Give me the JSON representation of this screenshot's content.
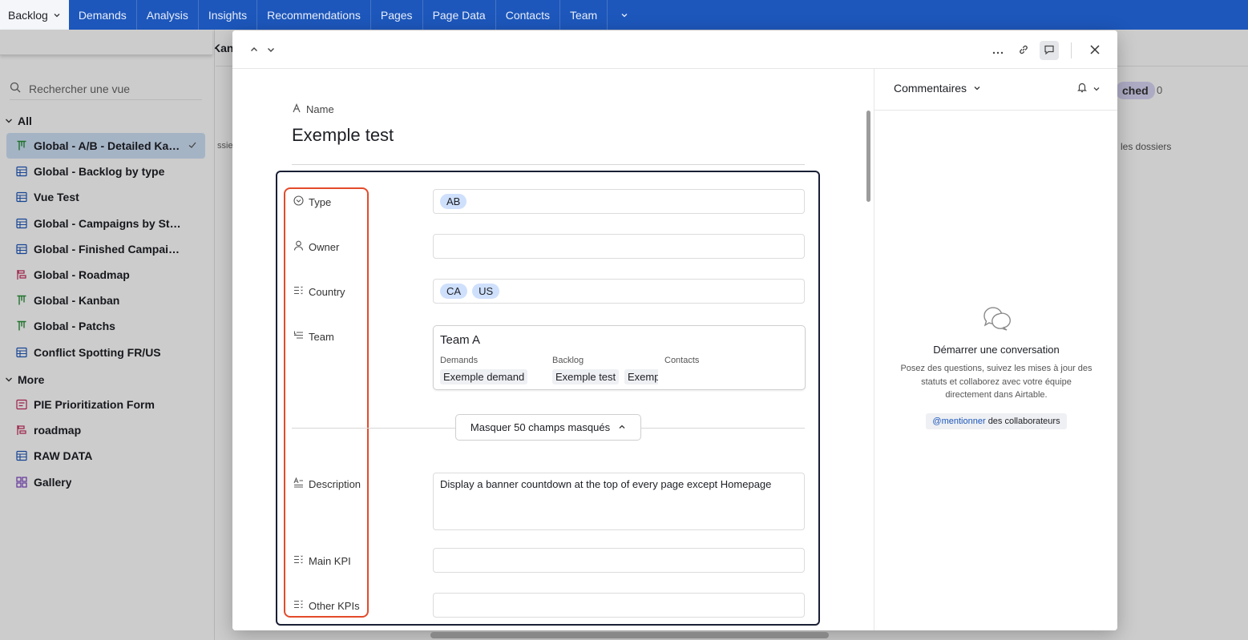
{
  "topnav": {
    "tabs": [
      {
        "label": "Backlog",
        "active": true
      },
      {
        "label": "Demands"
      },
      {
        "label": "Analysis"
      },
      {
        "label": "Insights"
      },
      {
        "label": "Recommendations"
      },
      {
        "label": "Pages"
      },
      {
        "label": "Page Data"
      },
      {
        "label": "Contacts"
      },
      {
        "label": "Team"
      }
    ],
    "more_icon": "chevron-down-icon"
  },
  "sidebar": {
    "search_placeholder": "Rechercher une vue",
    "group_all": "All",
    "group_more": "More",
    "views_all": [
      {
        "label": "Global - A/B - Detailed Kanban",
        "icon": "kanban-icon",
        "selected": true
      },
      {
        "label": "Global - Backlog by type",
        "icon": "grid-icon"
      },
      {
        "label": "Vue Test",
        "icon": "grid-icon"
      },
      {
        "label": "Global - Campaigns by Status",
        "icon": "grid-icon"
      },
      {
        "label": "Global - Finished Campaigns",
        "icon": "grid-icon"
      },
      {
        "label": "Global - Roadmap",
        "icon": "timeline-icon"
      },
      {
        "label": "Global - Kanban",
        "icon": "kanban-icon"
      },
      {
        "label": "Global - Patchs",
        "icon": "kanban-icon"
      },
      {
        "label": "Conflict Spotting FR/US",
        "icon": "grid-icon"
      }
    ],
    "views_more": [
      {
        "label": "PIE Prioritization Form",
        "icon": "form-icon"
      },
      {
        "label": "roadmap",
        "icon": "timeline-icon"
      },
      {
        "label": "RAW DATA",
        "icon": "grid-icon"
      },
      {
        "label": "Gallery",
        "icon": "gallery-icon"
      }
    ]
  },
  "background": {
    "kanban_fragment": "Kanl",
    "hatched_fragment": "ched",
    "hatched_count": "0",
    "folders_fragment": "les dossiers",
    "dossier_fragment": "ssie"
  },
  "record": {
    "name_label": "Name",
    "title": "Exemple test",
    "fields": {
      "type_label": "Type",
      "type_values": [
        "AB"
      ],
      "owner_label": "Owner",
      "owner_value": "",
      "country_label": "Country",
      "country_values": [
        "CA",
        "US"
      ],
      "team_label": "Team",
      "team_card": {
        "title": "Team A",
        "demands_label": "Demands",
        "demands_value": "Exemple demand",
        "backlog_label": "Backlog",
        "backlog_value_1": "Exemple test",
        "backlog_value_2": "Exemp",
        "contacts_label": "Contacts"
      },
      "hide_fields_button": "Masquer 50 champs masqués",
      "description_label": "Description",
      "description_value": "Display a banner countdown at the top of every page except Homepage",
      "main_kpi_label": "Main KPI",
      "other_kpis_label": "Other KPIs"
    }
  },
  "comments": {
    "header": "Commentaires",
    "empty_title": "Démarrer une conversation",
    "empty_desc": "Posez des questions, suivez les mises à jour des statuts et collaborez avec votre équipe directement dans Airtable.",
    "mention_link": "@mentionner",
    "mention_rest": "des collaborateurs"
  },
  "colors": {
    "topnav": "#1d57bb",
    "highlight_red": "#e34b2a",
    "chip_blue": "#cfe0fc"
  }
}
